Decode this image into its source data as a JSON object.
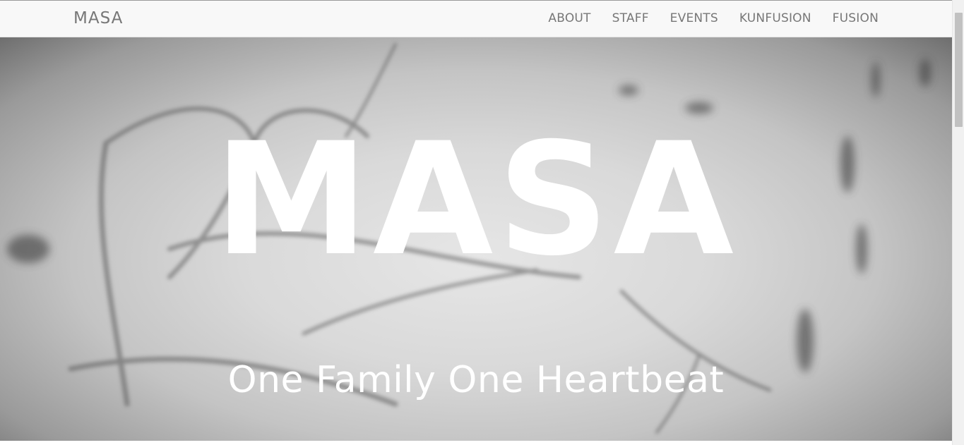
{
  "navbar": {
    "brand": "MASA",
    "links": [
      {
        "label": "ABOUT"
      },
      {
        "label": "STAFF"
      },
      {
        "label": "EVENTS"
      },
      {
        "label": "KUNFUSION"
      },
      {
        "label": "FUSION"
      }
    ]
  },
  "hero": {
    "title": "MASA",
    "tagline": "One Family One Heartbeat",
    "background_icon": "heart-drawn-in-sand-image"
  },
  "colors": {
    "navbar_bg": "#f8f8f8",
    "nav_text": "#777777",
    "hero_text": "#ffffff"
  }
}
